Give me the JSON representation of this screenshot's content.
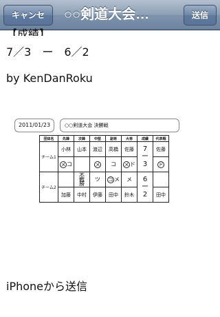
{
  "navbar": {
    "cancel_label": "キャンセル",
    "title": "○○剣道大会…",
    "send_label": "送信"
  },
  "body": {
    "line_cut": "【成績】",
    "line_score": "7／3　ー　6／2",
    "line_by": "by KenDanRoku",
    "footer": "iPhoneから送信"
  },
  "scoresheet": {
    "date": "2011/01/23",
    "match_name": "○○剣道大会 決勝戦",
    "headers": [
      "団体名",
      "先鋒",
      "次鋒",
      "中堅",
      "副将",
      "大将",
      "成績",
      "代表戦"
    ],
    "team1": {
      "name": "チーム1",
      "players": [
        "小林",
        "山本",
        "渡辺",
        "高橋",
        "佐藤",
        "佐藤"
      ],
      "waza": [
        {
          "circle": "メ",
          "text": "コ"
        },
        {
          "circle": "",
          "text": ""
        },
        {
          "circle": "メ",
          "text": ""
        },
        {
          "circle": "",
          "text": "コ"
        },
        {
          "circle": "メ",
          "text": "ド"
        }
      ],
      "daihyo_waza": "ド",
      "score_top": "7",
      "score_dash": "ー",
      "score_bottom": "3"
    },
    "team2": {
      "name": "チーム2",
      "players": [
        "加藤",
        "中村",
        "伊藤",
        "田中",
        "鈴木",
        "田中"
      ],
      "waza": [
        {
          "circle": "",
          "text": ""
        },
        {
          "circle": "",
          "text": "不戦勝"
        },
        {
          "circle": "",
          "text": "ツ"
        },
        {
          "circle": "コ",
          "text": "メ"
        },
        {
          "circle": "",
          "text": "メ"
        }
      ],
      "score_top": "6",
      "score_dash": "ー",
      "score_bottom": "2"
    }
  }
}
